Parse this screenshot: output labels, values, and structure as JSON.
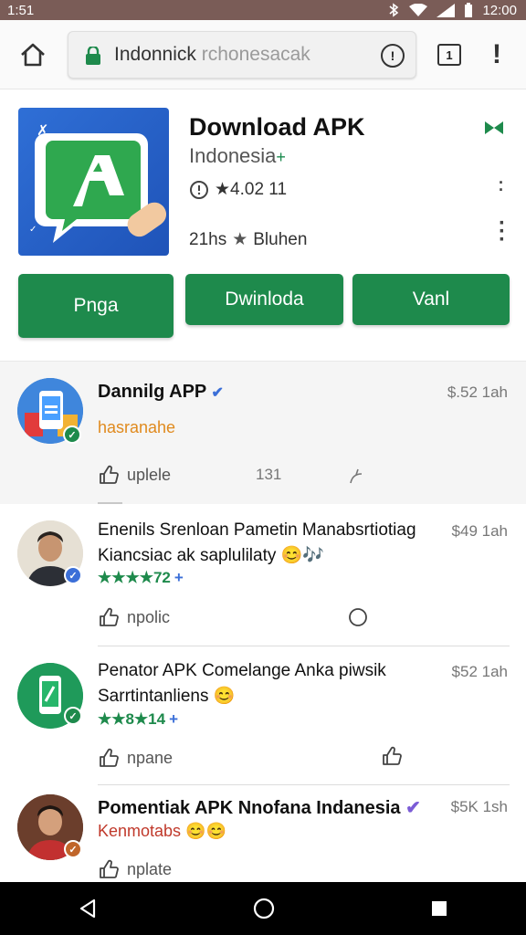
{
  "status_bar": {
    "time": "1:51",
    "clock": "12:00"
  },
  "browser": {
    "url_main": "Indonnick",
    "url_dim": " rchonesacak",
    "tab_count": "1"
  },
  "app": {
    "title": "Download APK",
    "subtitle": "Indonesia",
    "subtitle_plus": "+",
    "rating": "★4.02 11",
    "meta_time": "21hs",
    "meta_author": "Bluhen",
    "buttons": [
      "Pnga",
      "Dwinloda",
      "Vanl"
    ]
  },
  "posts": [
    {
      "author": "Dannilg APP",
      "time": "$.52 1ah",
      "subtitle": "hasranahe",
      "subtitle_color": "#e08a1e",
      "action_label": "uplele",
      "count": "131"
    },
    {
      "line1": "Enenils Srenloan Pametin Manabsrtiotiag",
      "line2": "Kiancsiac ak saplulilaty 😊🎶",
      "time": "$49 1ah",
      "stars": "★★★★72",
      "stars_add": "+",
      "action_label": "npolic"
    },
    {
      "line1": "Penator APK Comelange Anka piwsik",
      "line2": "Sarrtintanliens 😊",
      "time": "$52 1ah",
      "stars": "★★8★14",
      "stars_add": "+",
      "action_label": "npane"
    },
    {
      "author": "Pomentiak APK Nnofana Indanesia",
      "time": "$5K 1sh",
      "subtitle": "Kenmotabs 😊😊",
      "subtitle_color": "#c0392b",
      "action_label": "nplate"
    }
  ],
  "colors": {
    "accent_green": "#1e8a4c",
    "status_bar": "#7a5c57",
    "verified_blue": "#3b6fd8"
  }
}
